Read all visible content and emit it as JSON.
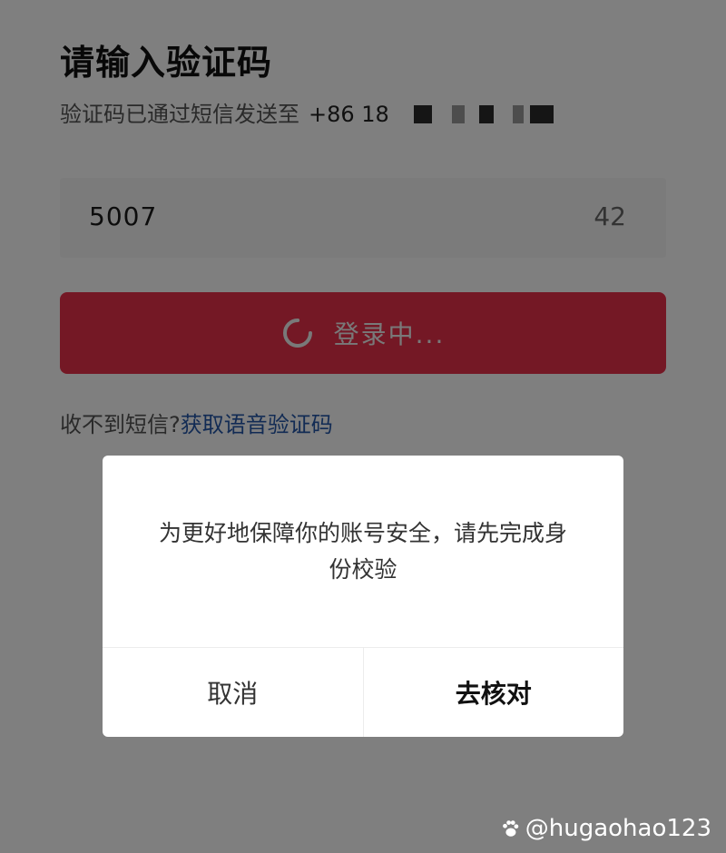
{
  "screen": {
    "title": "请输入验证码",
    "sent_to_label": "验证码已通过短信发送至",
    "phone_prefix": "+86 18"
  },
  "code_input": {
    "value": "5007",
    "countdown": "42"
  },
  "login_button": {
    "label": "登录中..."
  },
  "help": {
    "no_sms": "收不到短信?",
    "voice_code_link": "获取语音验证码"
  },
  "dialog": {
    "message": "为更好地保障你的账号安全，请先完成身份校验",
    "cancel_label": "取消",
    "confirm_label": "去核对"
  },
  "watermark": {
    "text": "@hugaohao123",
    "icon": "paw-icon"
  },
  "colors": {
    "primary": "#e8304a",
    "link": "#2457a8"
  }
}
